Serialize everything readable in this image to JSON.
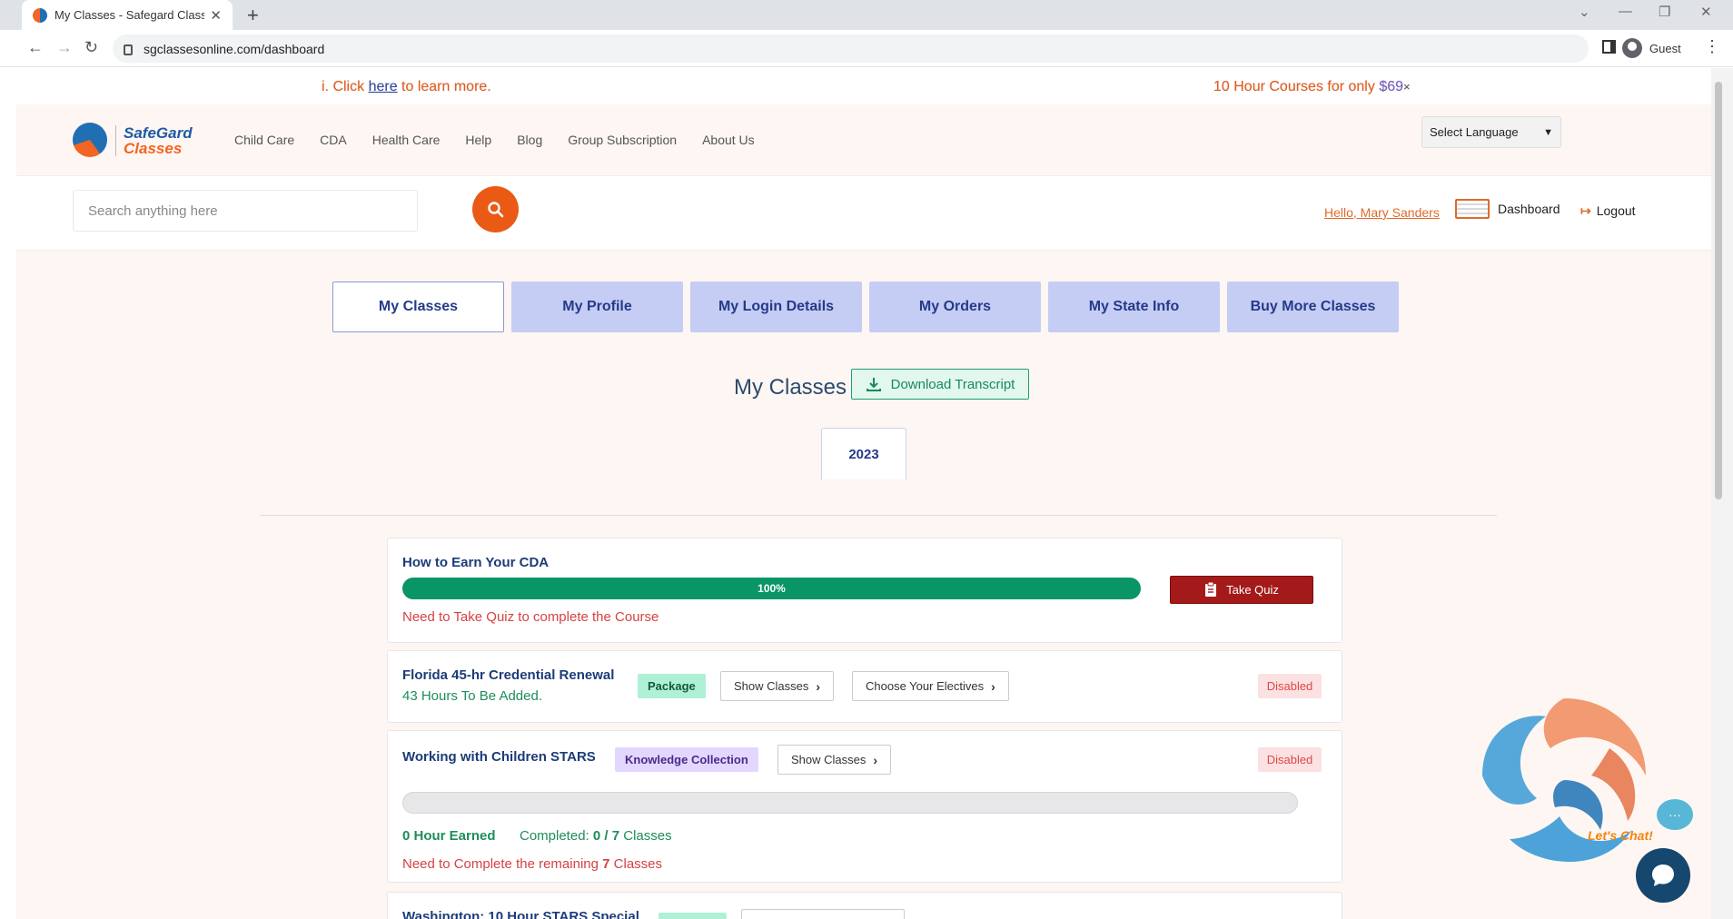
{
  "browser": {
    "tab_title": "My Classes - Safegard Classes O",
    "url": "sgclassesonline.com/dashboard",
    "profile": "Guest"
  },
  "promo": {
    "left_prefix": "i. Click ",
    "left_link": "here",
    "left_suffix": " to learn more.",
    "right_text": "10 Hour Courses for only ",
    "right_price": "$69",
    "close": "×"
  },
  "nav": {
    "logo_line1": "SafeGard",
    "logo_line2": "Classes",
    "items": [
      "Child Care",
      "CDA",
      "Health Care",
      "Help",
      "Blog",
      "Group Subscription",
      "About Us"
    ],
    "language": "Select Language"
  },
  "search": {
    "placeholder": "Search anything here"
  },
  "user": {
    "hello": "Hello, Mary Sanders",
    "dashboard": "Dashboard",
    "logout": "Logout"
  },
  "dashboard_tabs": [
    "My Classes",
    "My Profile",
    "My Login Details",
    "My Orders",
    "My State Info",
    "Buy More Classes"
  ],
  "main": {
    "title": "My Classes",
    "download": "Download Transcript",
    "year": "2023"
  },
  "courses": [
    {
      "name": "How to Earn Your CDA",
      "progress": "100%",
      "note": "Need to Take Quiz to complete the Course",
      "action": "Take Quiz"
    },
    {
      "name": "Florida 45-hr Credential Renewal",
      "badge": "Package",
      "hours": "43 Hours To Be Added.",
      "btn1": "Show Classes",
      "btn2": "Choose Your Electives",
      "status": "Disabled"
    },
    {
      "name": "Working with Children STARS",
      "badge": "Knowledge Collection",
      "btn1": "Show Classes",
      "status": "Disabled",
      "earned": "0 Hour Earned",
      "completed_label": "Completed:",
      "completed_value": "0 / 7",
      "completed_unit": "Classes",
      "remaining_prefix": "Need to Complete the remaining",
      "remaining_count": "7",
      "remaining_unit": "Classes"
    },
    {
      "name": "Washington: 10 Hour STARS Special"
    }
  ],
  "chat": {
    "label": "Let's Chat!",
    "bubble": "···"
  },
  "colors": {
    "accent_orange": "#ea5a15",
    "tab_blue": "#c5cdf5",
    "progress_green": "#0a9567",
    "quiz_red": "#a41a1a"
  }
}
